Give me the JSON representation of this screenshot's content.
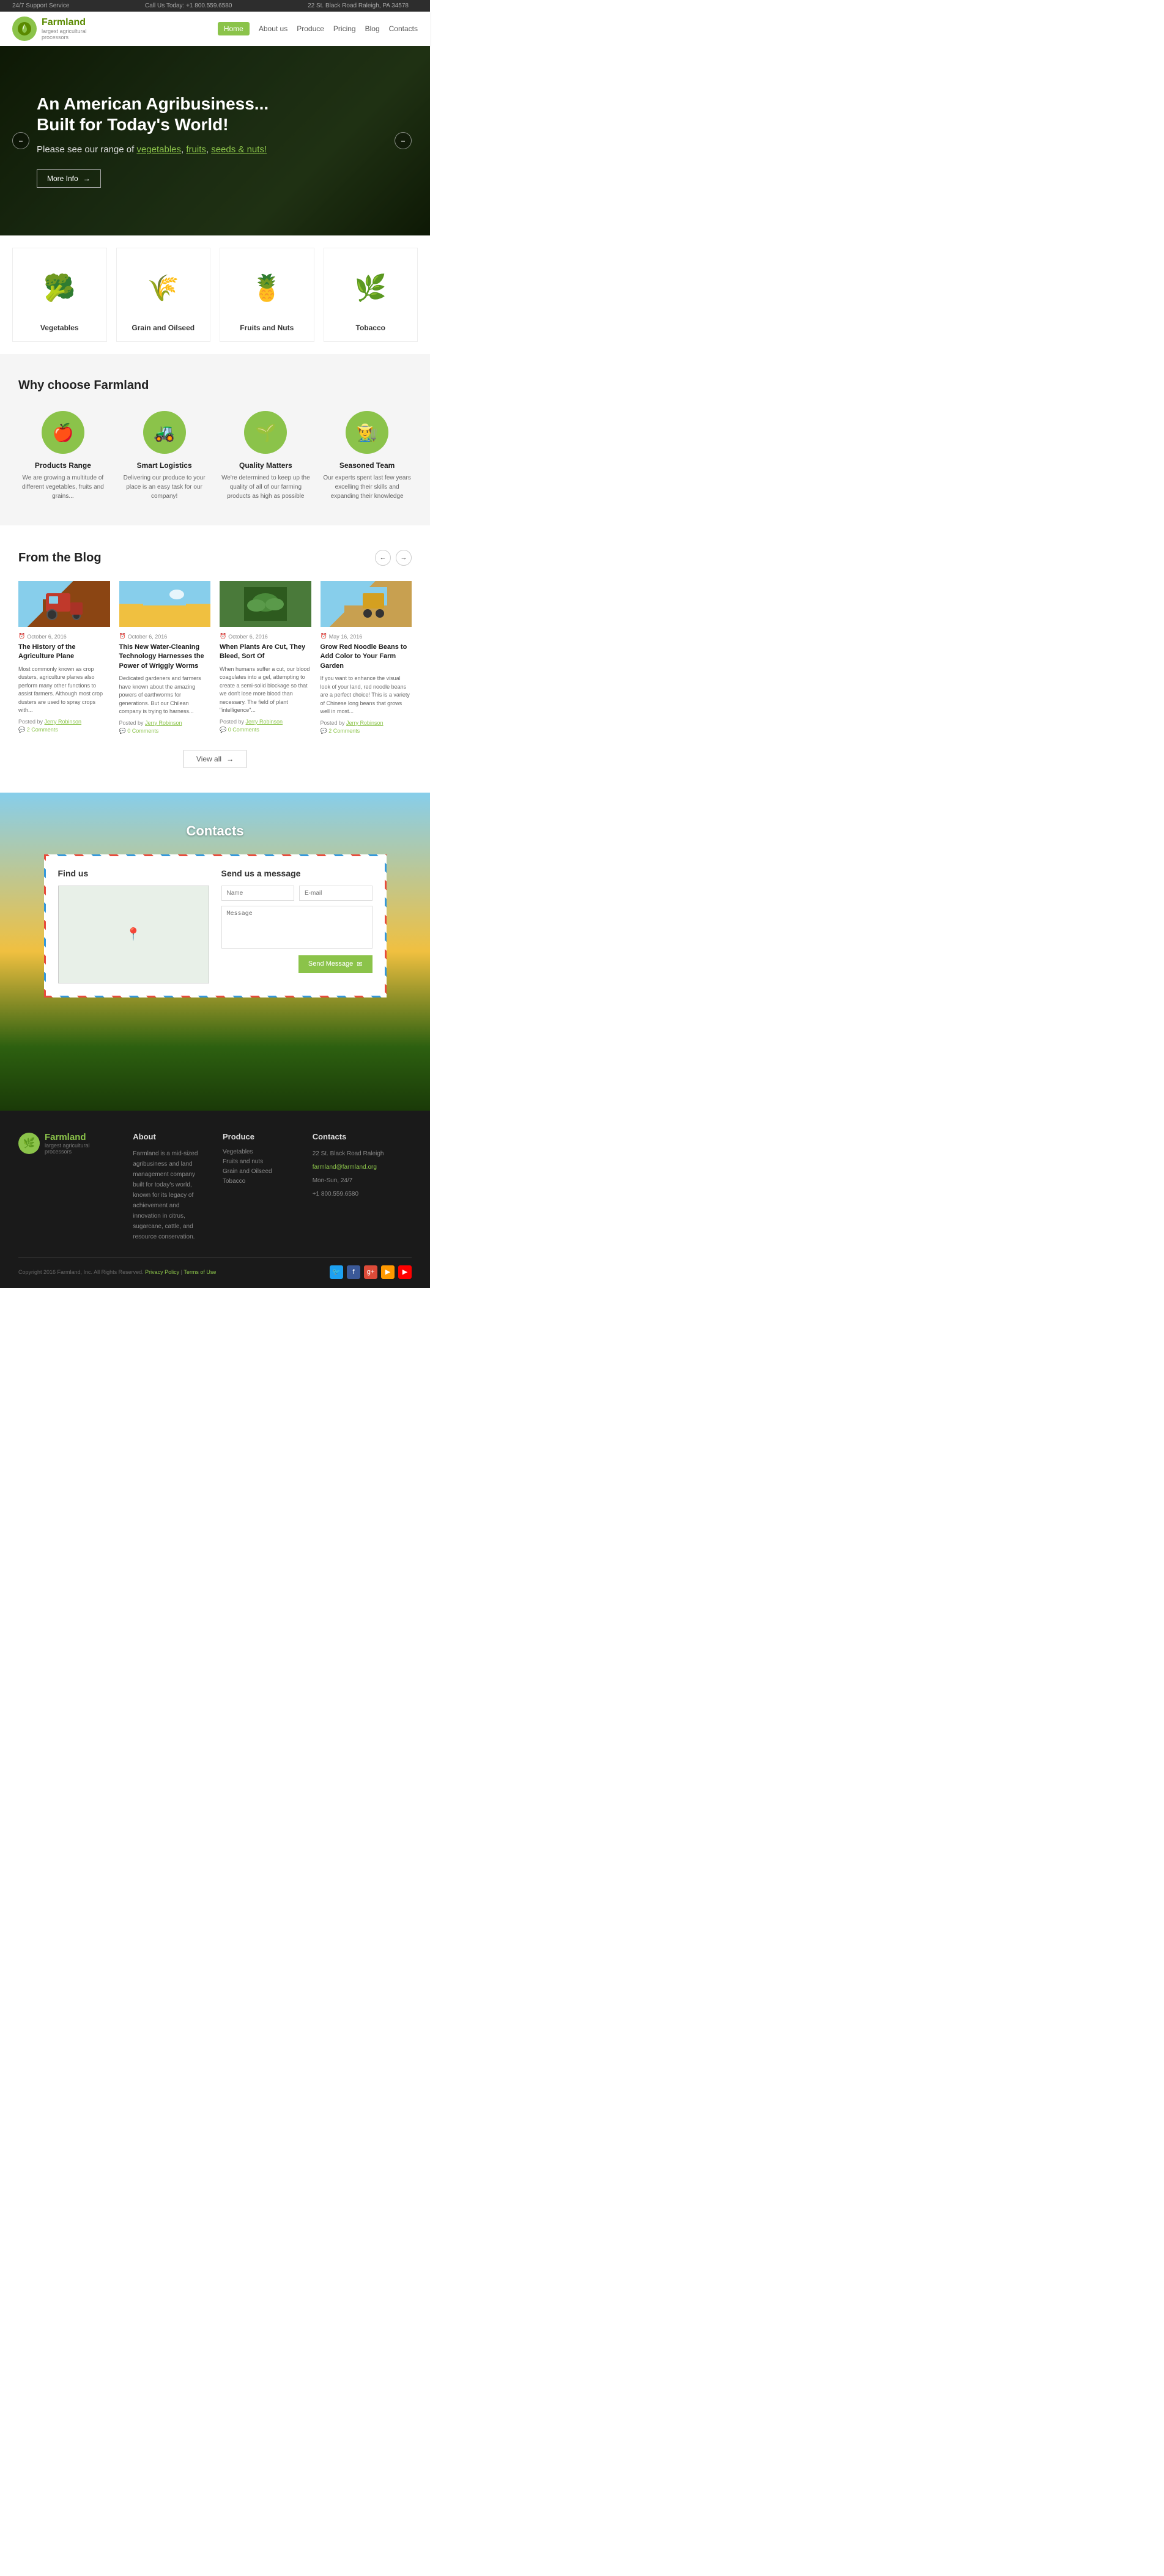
{
  "topbar": {
    "support": "24/7 Support Service",
    "phone_label": "Call Us Today: +1 800.559.6580",
    "address": "22 St. Black Road Raleigh, PA 34578"
  },
  "nav": {
    "logo_name": "Farmland",
    "logo_sub": "largest agricultural\nprocessors",
    "links": [
      "Home",
      "About us",
      "Produce",
      "Pricing",
      "Blog",
      "Contacts"
    ]
  },
  "hero": {
    "headline": "An American Agribusiness... Built for Today's World!",
    "subtext": "Please see our range of vegetables, fruits, seeds & nuts!",
    "btn_label": "More Info"
  },
  "categories": [
    {
      "name": "Vegetables",
      "emoji": "🥦"
    },
    {
      "name": "Grain and Oilseed",
      "emoji": "🌾"
    },
    {
      "name": "Fruits and Nuts",
      "emoji": "🍍"
    },
    {
      "name": "Tobacco",
      "emoji": "🌿"
    }
  ],
  "why": {
    "title": "Why choose Farmland",
    "items": [
      {
        "icon": "🍎",
        "title": "Products Range",
        "text": "We are growing a multitude of different vegetables, fruits and grains..."
      },
      {
        "icon": "🚜",
        "title": "Smart Logistics",
        "text": "Delivering our produce to your place is an easy task for our company!"
      },
      {
        "icon": "🌱",
        "title": "Quality Matters",
        "text": "We're determined to keep up the quality of all of our farming products as high as possible"
      },
      {
        "icon": "👨‍🌾",
        "title": "Seasoned Team",
        "text": "Our experts spent last few years excelling their skills and expanding their knowledge"
      }
    ]
  },
  "blog": {
    "title": "From the Blog",
    "posts": [
      {
        "date": "October 6, 2016",
        "title": "The History of the Agriculture Plane",
        "excerpt": "Most commonly known as crop dusters, agriculture planes also perform many other functions to assist farmers. Although most crop dusters are used to spray crops with...",
        "author": "Jerry Robinson",
        "comments": "2 Comments",
        "img_type": "tractor"
      },
      {
        "date": "October 6, 2016",
        "title": "This New Water-Cleaning Technology Harnesses the Power of Wriggly Worms",
        "excerpt": "Dedicated gardeners and farmers have known about the amazing powers of earthworms for generations. But our Chilean company is trying to harness...",
        "author": "Jerry Robinson",
        "comments": "0 Comments",
        "img_type": "field"
      },
      {
        "date": "October 6, 2016",
        "title": "When Plants Are Cut, They Bleed, Sort Of",
        "excerpt": "When humans suffer a cut, our blood coagulates into a gel, attempting to create a semi-solid blockage so that we don't lose more blood than necessary. The field of plant \"intelligence\"...",
        "author": "Jerry Robinson",
        "comments": "0 Comments",
        "img_type": "plant"
      },
      {
        "date": "May 16, 2016",
        "title": "Grow Red Noodle Beans to Add Color to Your Farm Garden",
        "excerpt": "If you want to enhance the visual look of your land, red noodle beans are a perfect choice! This is a variety of Chinese long beans that grows well in most...",
        "author": "Jerry Robinson",
        "comments": "2 Comments",
        "img_type": "harvest"
      }
    ],
    "view_all_label": "View all"
  },
  "contacts": {
    "title": "Contacts",
    "find_us_title": "Find us",
    "send_msg_title": "Send us a message",
    "name_placeholder": "Name",
    "email_placeholder": "E-mail",
    "message_placeholder": "Message",
    "send_btn": "Send Message"
  },
  "footer": {
    "logo_name": "Farmland",
    "logo_sub": "largest agricultural\nprocessors",
    "about_title": "About",
    "about_text": "Farmland is a mid-sized agribusiness and land management company built for today's world, known for its legacy of achievement and innovation in citrus, sugarcane, cattle, and resource conservation.",
    "produce_title": "Produce",
    "produce_links": [
      "Vegetables",
      "Fruits and nuts",
      "Grain and Oilseed",
      "Tobacco"
    ],
    "contacts_title": "Contacts",
    "contact_address": "22 St. Black Road Raleigh",
    "contact_email": "farmland@farmland.org",
    "contact_hours": "Mon-Sun, 24/7",
    "contact_phone": "+1 800.559.6580",
    "copyright": "Copyright 2016 Farmland, Inc. All Rights Reserved.",
    "privacy_label": "Privacy Policy",
    "terms_label": "Terms of Use"
  }
}
